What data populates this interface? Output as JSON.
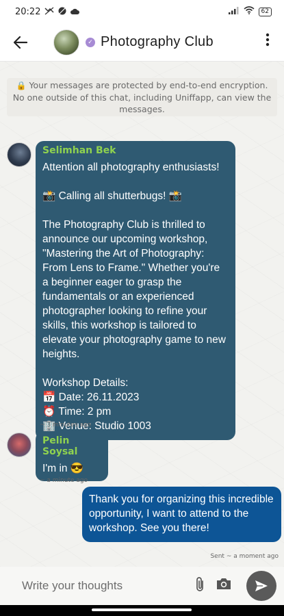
{
  "status_bar": {
    "time": "20:22",
    "battery": "62"
  },
  "header": {
    "title": "Photography Club"
  },
  "chat": {
    "encryption_notice": "Your messages are protected by end-to-end encryption. No one outside of this chat, including Uniffapp, can view the messages.",
    "messages": [
      {
        "sender": "Selimhan Bek",
        "text": "Attention all photography enthusiasts!\n\n📸 Calling all shutterbugs! 📸\n\nThe Photography Club is thrilled to announce our upcoming workshop, \"Mastering the Art of Photography: From Lens to Frame.\" Whether you're a beginner eager to grasp the fundamentals or an experienced photographer looking to refine your skills, this workshop is tailored to elevate your photography game to new heights.\n\nWorkshop Details:\n📅 Date: 26.11.2023\n⏰ Time: 2 pm\n🏢 Venue: Studio 1003",
        "time": "~ 3 minutes ago"
      },
      {
        "sender": "Pelin Soysal",
        "text": "I'm in 😎",
        "time": "~ a minute ago"
      },
      {
        "sender": "",
        "text": "Thank you for organizing this incredible opportunity, I want to attend to the workshop. See you there!",
        "time": "Sent ~ a moment ago"
      }
    ]
  },
  "composer": {
    "placeholder": "Write your thoughts"
  },
  "colors": {
    "incoming_bubble": "#2f5a72",
    "outgoing_bubble": "#0d5596",
    "sender_name": "#8fd24f"
  }
}
